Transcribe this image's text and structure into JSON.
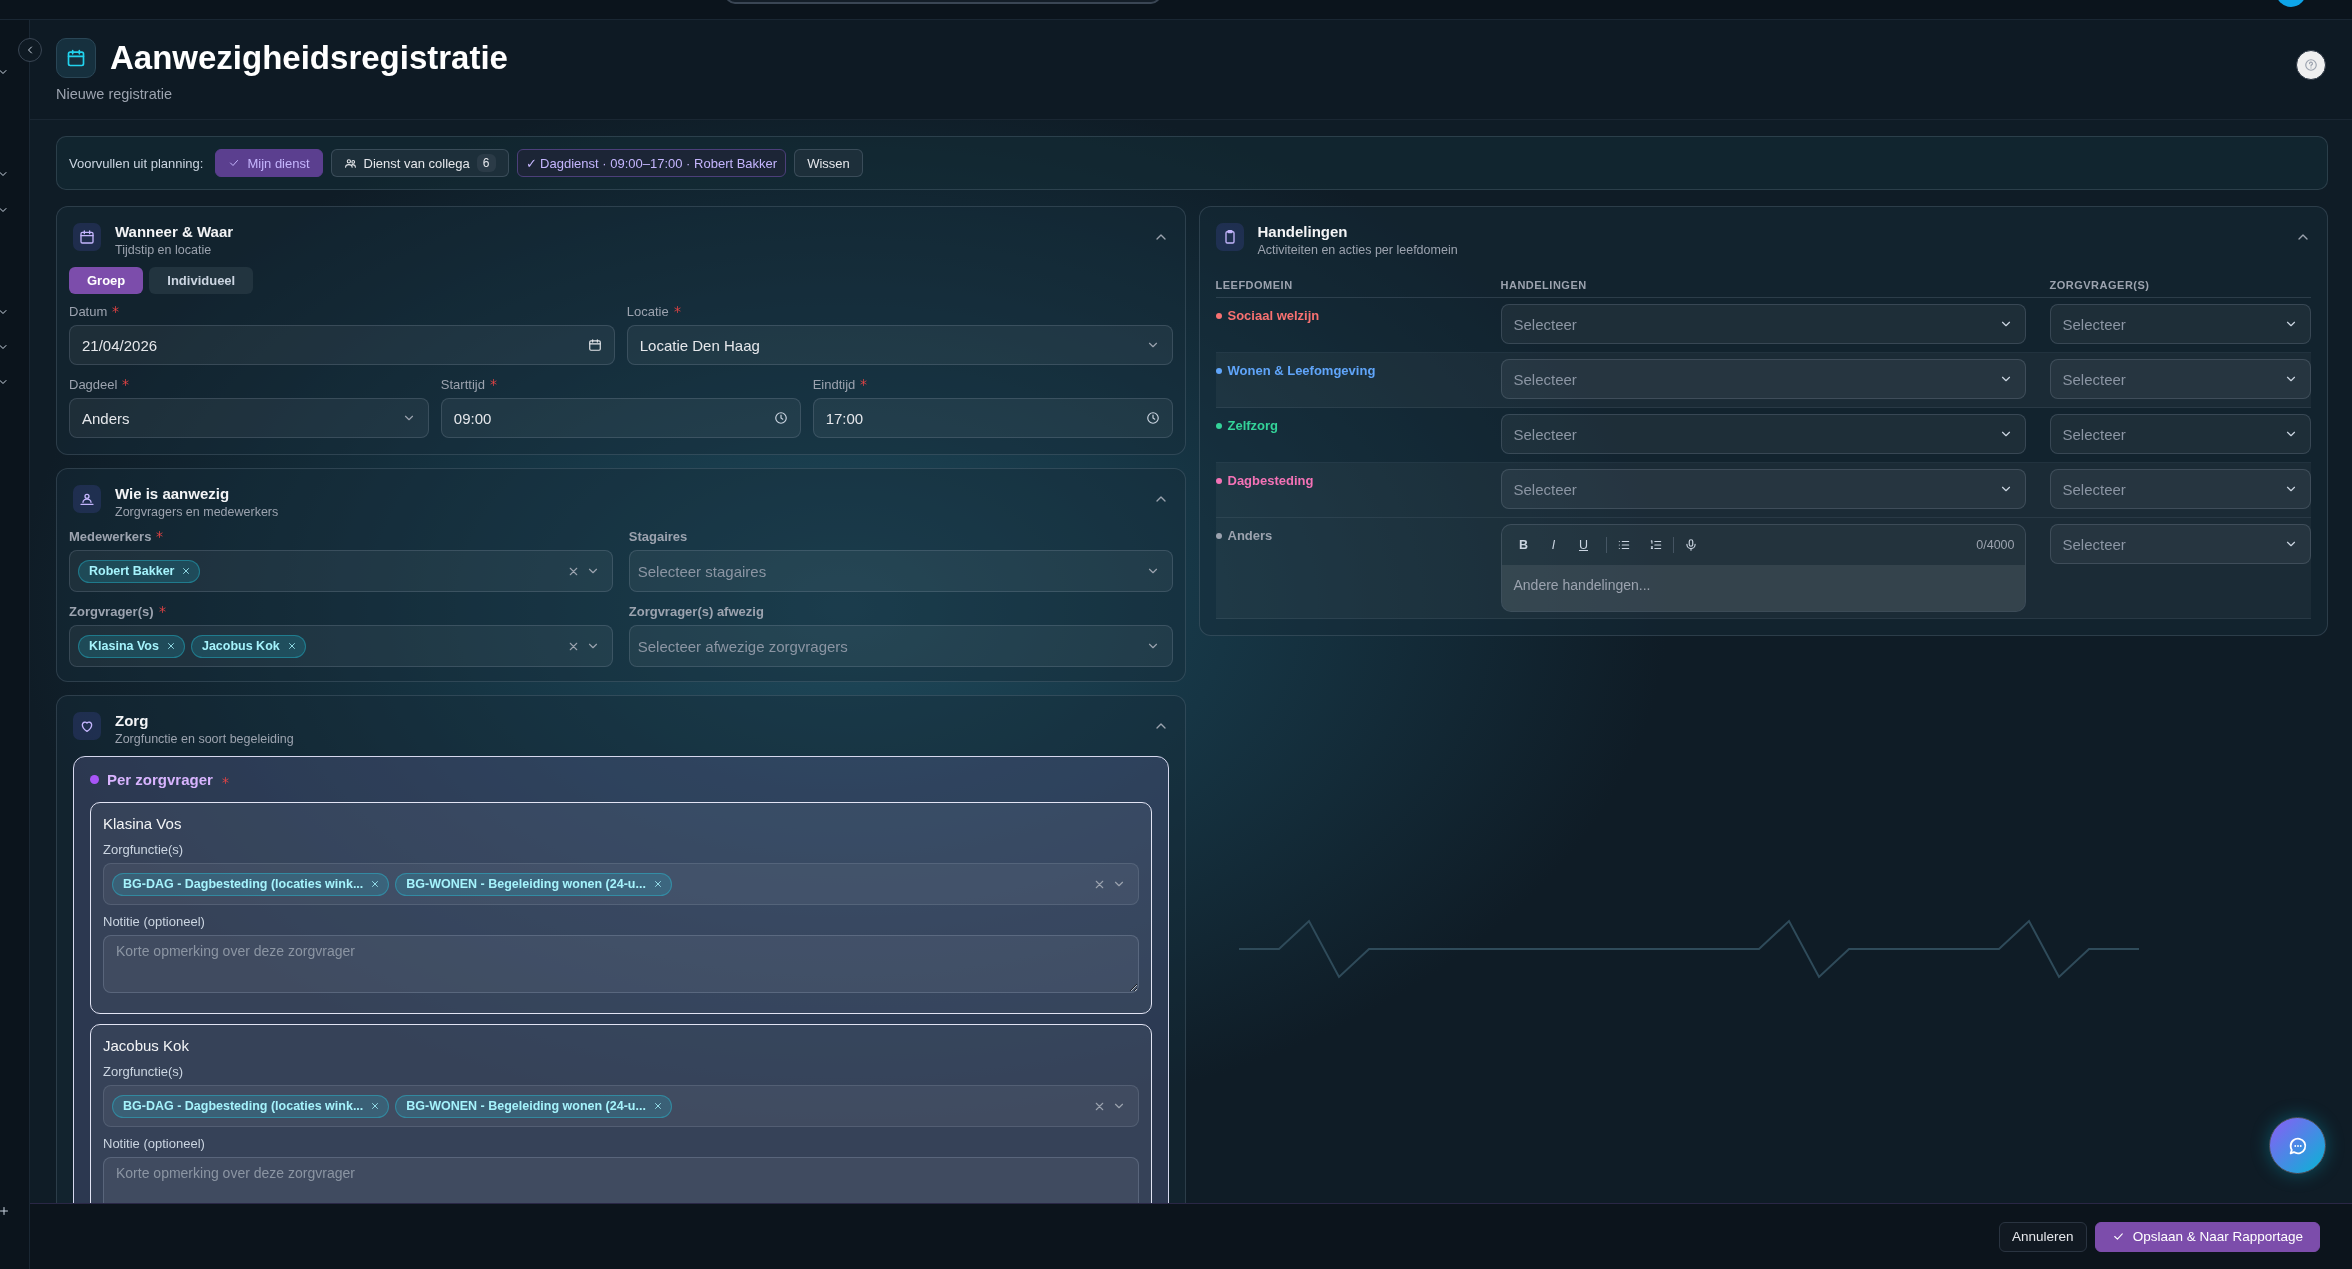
{
  "header": {
    "title": "Aanwezigheidsregistratie",
    "subtitle": "Nieuwe registratie"
  },
  "prefill": {
    "label": "Voorvullen uit planning:",
    "buttons": [
      {
        "label": "Mijn dienst",
        "kind": "toggle",
        "selected": true
      },
      {
        "label": "Dienst van collega",
        "kind": "count",
        "count": "6",
        "selected": false
      },
      {
        "label": "✓ Dagdienst · 09:00–17:00 · Robert Bakker",
        "kind": "info"
      },
      {
        "label": "Wissen",
        "kind": "plain"
      }
    ]
  },
  "when_where": {
    "title": "Wanneer & Waar",
    "subtitle": "Tijdstip en locatie",
    "expanded": true,
    "modes": [
      {
        "label": "Groep",
        "selected": true
      },
      {
        "label": "Individueel",
        "selected": false
      }
    ],
    "fields": [
      {
        "label": "Datum",
        "required": true,
        "value": "21/04/2026",
        "kind": "date"
      },
      {
        "label": "Locatie",
        "required": true,
        "value": "Locatie Den Haag",
        "kind": "select"
      },
      {
        "label": "Dagdeel",
        "required": true,
        "value": "Anders",
        "kind": "select"
      },
      {
        "label": "Starttijd",
        "required": true,
        "value": "09:00",
        "kind": "time"
      },
      {
        "label": "Eindtijd",
        "required": true,
        "value": "17:00",
        "kind": "time"
      }
    ]
  },
  "attendance": {
    "title": "Wie is aanwezig",
    "subtitle": "Zorgvragers en medewerkers",
    "expanded": true,
    "fields": [
      {
        "label": "Medewerkers",
        "required": true,
        "tags": [
          "Robert Bakker"
        ]
      },
      {
        "label": "Stagaires",
        "required": false,
        "placeholder": "Selecteer stagaires"
      },
      {
        "label": "Zorgvrager(s)",
        "required": true,
        "tags": [
          "Klasina Vos",
          "Jacobus Kok"
        ]
      },
      {
        "label": "Zorgvrager(s) afwezig",
        "required": false,
        "placeholder": "Selecteer afwezige zorgvragers"
      }
    ]
  },
  "care": {
    "title": "Zorg",
    "subtitle": "Zorgfunctie en soort begeleiding",
    "expanded": true,
    "group": {
      "label": "Per zorgvrager",
      "required": true,
      "clients": [
        {
          "name": "Klasina Vos",
          "functions_label": "Zorgfunctie(s)",
          "tags": [
            "BG-DAG - Dagbesteding (locaties wink...",
            "BG-WONEN - Begeleiding wonen (24-u..."
          ],
          "note_label": "Notitie (optioneel)",
          "note_placeholder": "Korte opmerking over deze zorgvrager"
        },
        {
          "name": "Jacobus Kok",
          "functions_label": "Zorgfunctie(s)",
          "tags": [
            "BG-DAG - Dagbesteding (locaties wink...",
            "BG-WONEN - Begeleiding wonen (24-u..."
          ],
          "note_label": "Notitie (optioneel)",
          "note_placeholder": "Korte opmerking over deze zorgvrager"
        }
      ]
    }
  },
  "actions": {
    "title": "Handelingen",
    "subtitle": "Activiteiten en acties per leefdomein",
    "expanded": true,
    "columns": [
      "LEEFDOMEIN",
      "HANDELINGEN",
      "ZORGVRAGER(S)"
    ],
    "rows": [
      {
        "domain": "Sociaal welzijn",
        "color": "#f87171",
        "kind": "select",
        "actions_placeholder": "Selecteer",
        "clients_placeholder": "Selecteer"
      },
      {
        "domain": "Wonen & Leefomgeving",
        "color": "#60a5fa",
        "kind": "select",
        "actions_placeholder": "Selecteer",
        "clients_placeholder": "Selecteer"
      },
      {
        "domain": "Zelfzorg",
        "color": "#34d399",
        "kind": "select",
        "actions_placeholder": "Selecteer",
        "clients_placeholder": "Selecteer"
      },
      {
        "domain": "Dagbesteding",
        "color": "#f472b6",
        "kind": "select",
        "actions_placeholder": "Selecteer",
        "clients_placeholder": "Selecteer"
      },
      {
        "domain": "Anders",
        "color": "#9ca3af",
        "kind": "editor",
        "toolbar": [
          {
            "label": "B",
            "kind": "bold"
          },
          {
            "label": "I",
            "kind": "italic"
          },
          {
            "label": "U",
            "kind": "underline"
          }
        ],
        "counter": "0/4000",
        "actions_placeholder": "Andere handelingen...",
        "clients_placeholder": "Selecteer"
      }
    ]
  },
  "footer": {
    "buttons": [
      {
        "label": "Annuleren",
        "kind": "secondary"
      },
      {
        "label": "Opslaan & Naar Rapportage",
        "kind": "primary"
      }
    ]
  }
}
